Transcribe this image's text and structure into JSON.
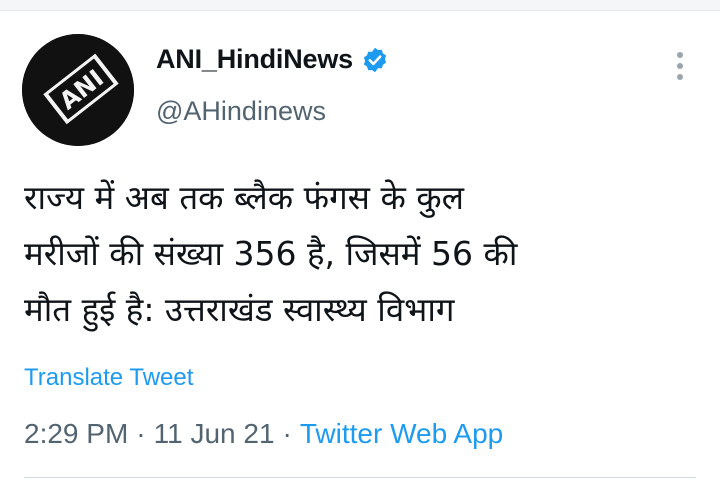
{
  "author": {
    "display_name": "ANI_HindiNews",
    "handle": "@AHindinews",
    "verified": true,
    "avatar_text": "ANI"
  },
  "icons": {
    "verified": "verified-badge-icon",
    "more": "more-vertical-icon"
  },
  "tweet": {
    "text": "राज्य में अब तक ब्लैक फंगस के कुल\nमरीजों की संख्या 356 है, जिसमें 56 की\nमौत हुई है: उत्तराखंड स्वास्थ्य विभाग"
  },
  "translate_label": "Translate Tweet",
  "meta": {
    "time": "2:29 PM",
    "date": "11 Jun 21",
    "separator": "·",
    "source": "Twitter Web App"
  },
  "colors": {
    "accent": "#1d9bf0",
    "secondary_text": "#536471",
    "primary_text": "#0f1419"
  }
}
